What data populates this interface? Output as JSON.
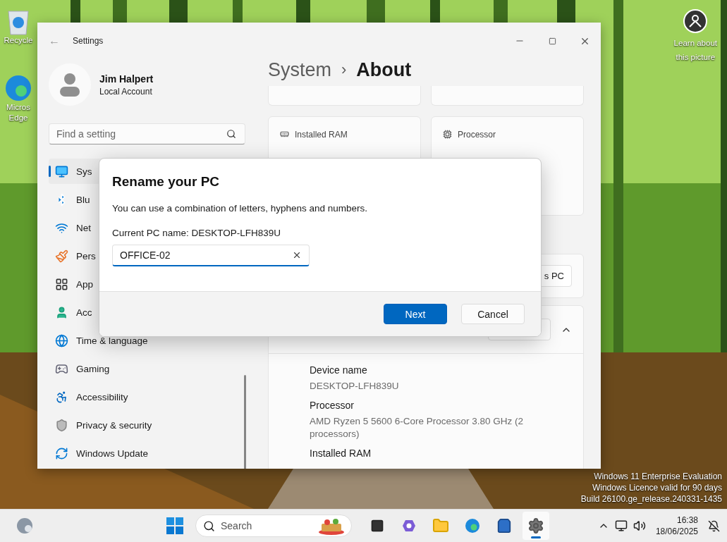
{
  "desktop_icons": [
    {
      "lines": [
        "Recycle"
      ]
    },
    {
      "lines": [
        "Micros",
        "Edge"
      ]
    }
  ],
  "wallpaper_info": {
    "lines": [
      "Learn about",
      "this picture"
    ]
  },
  "settings": {
    "title": "Settings",
    "back": "←",
    "user": {
      "name": "Jim Halpert",
      "account": "Local Account"
    },
    "search": {
      "placeholder": "Find a setting"
    },
    "nav": [
      {
        "label": "Sys",
        "selected": true
      },
      {
        "label": "Blu",
        "selected": false
      },
      {
        "label": "Net",
        "selected": false
      },
      {
        "label": "Pers",
        "selected": false
      },
      {
        "label": "App",
        "selected": false
      },
      {
        "label": "Acc",
        "selected": false
      },
      {
        "label": "Time & language",
        "selected": false
      },
      {
        "label": "Gaming",
        "selected": false
      },
      {
        "label": "Accessibility",
        "selected": false
      },
      {
        "label": "Privacy & security",
        "selected": false
      },
      {
        "label": "Windows Update",
        "selected": false
      }
    ],
    "breadcrumb": {
      "parent": "System",
      "separator": "›",
      "current": "About"
    },
    "spec_cards": [
      {
        "label": "Installed RAM"
      },
      {
        "label": "Processor"
      }
    ],
    "rename_button": "s PC",
    "specs": [
      {
        "label": "Device name",
        "value": "DESKTOP-LFH839U"
      },
      {
        "label": "Processor",
        "value": "AMD Ryzen 5 5600 6-Core Processor 3.80 GHz  (2 processors)"
      },
      {
        "label": "Installed RAM"
      }
    ]
  },
  "dialog": {
    "title": "Rename your PC",
    "hint": "You can use a combination of letters, hyphens and numbers.",
    "current": "Current PC name: DESKTOP-LFH839U",
    "value": "OFFICE-02",
    "buttons": [
      {
        "label": "Next",
        "kind": "primary"
      },
      {
        "label": "Cancel",
        "kind": "secondary"
      }
    ]
  },
  "evaluation_notice": [
    "Windows 11 Enterprise Evaluation",
    "Windows Licence valid for 90 days",
    "Build 26100.ge_release.240331-1435"
  ],
  "taskbar": {
    "search_placeholder": "Search",
    "apps": [
      {
        "selected": false
      },
      {
        "selected": false
      },
      {
        "selected": false
      },
      {
        "selected": false
      },
      {
        "selected": false
      },
      {
        "selected": true
      }
    ],
    "clock": {
      "time": "16:38",
      "date": "18/06/2025"
    }
  }
}
